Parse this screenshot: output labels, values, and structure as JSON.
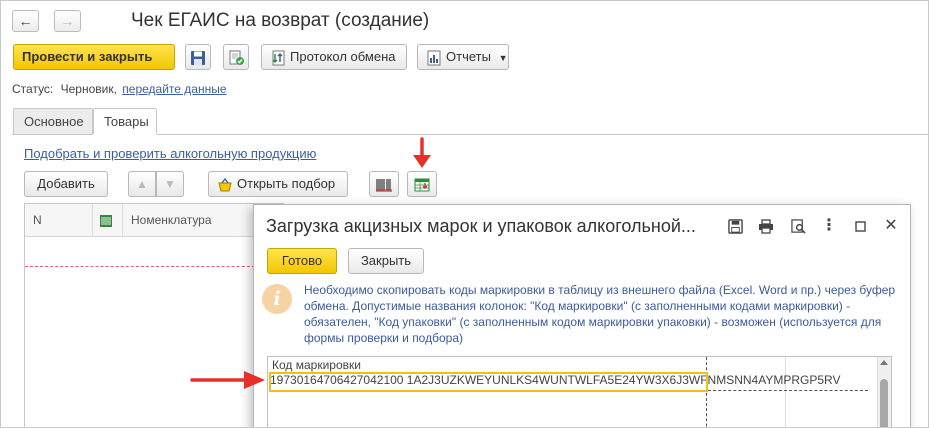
{
  "window": {
    "title": "Чек ЕГАИС на возврат (создание)"
  },
  "nav": {
    "back_icon": "arrow-left-icon",
    "forward_icon": "arrow-right-icon"
  },
  "toolbar": {
    "post_close_label": "Провести и закрыть",
    "exchange_log_label": "Протокол обмена",
    "reports_label": "Отчеты"
  },
  "status": {
    "label": "Статус:",
    "value": "Черновик,",
    "link": "передайте данные"
  },
  "tabs": [
    {
      "label": "Основное",
      "active": false
    },
    {
      "label": "Товары",
      "active": true
    }
  ],
  "goods": {
    "pick_link": "Подобрать и проверить алкогольную продукцию",
    "add_label": "Добавить",
    "open_selection_label": "Открыть подбор",
    "columns": [
      "N",
      "",
      "Номенклатура"
    ]
  },
  "dialog": {
    "title": "Загрузка акцизных марок и упаковок алкогольной...",
    "done_label": "Готово",
    "close_label": "Закрыть",
    "hint": "Необходимо скопировать коды маркировки в таблицу из внешнего файла (Excel. Word и пр.) через буфер обмена. Допустимые названия колонок: \"Код маркировки\" (с заполненными кодами маркировки) - обязателен, \"Код упаковки\" (с заполненным кодом маркировки упаковки) - возможен (используется для формы проверки и подбора)",
    "table_header": "Код маркировки",
    "row_value": "19730164706427042100 1A2J3UZKWEYUNLKS4WUNTWLFA5E24YW3X6J3WFNMSNN4AYMPRGP5RV"
  },
  "colors": {
    "accent_yellow": "#f2c600",
    "link_blue": "#3c5e9f",
    "annotation_red": "#e8302a",
    "highlight_border": "#f2bf18"
  }
}
